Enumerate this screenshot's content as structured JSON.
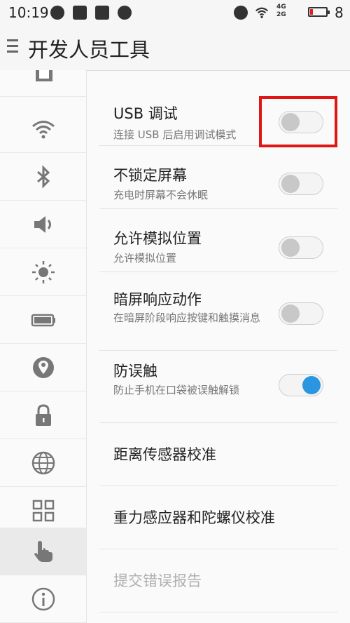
{
  "status": {
    "time": "10:19",
    "network_top": "4G",
    "network_bottom": "2G",
    "battery_level": "8"
  },
  "header": {
    "title": "开发人员工具"
  },
  "sidebar": {
    "items": [
      {
        "icon": "sim-card-icon"
      },
      {
        "icon": "wifi-icon"
      },
      {
        "icon": "bluetooth-icon"
      },
      {
        "icon": "speaker-icon"
      },
      {
        "icon": "brightness-icon"
      },
      {
        "icon": "battery-icon"
      },
      {
        "icon": "location-icon"
      },
      {
        "icon": "lock-icon"
      },
      {
        "icon": "globe-icon"
      },
      {
        "icon": "apps-grid-icon"
      },
      {
        "icon": "hand-pointer-icon",
        "active": true
      },
      {
        "icon": "info-icon"
      }
    ]
  },
  "settings": [
    {
      "title": "USB 调试",
      "subtitle": "连接 USB 后启用调试模式",
      "toggle_on": false
    },
    {
      "title": "不锁定屏幕",
      "subtitle": "充电时屏幕不会休眠",
      "toggle_on": false
    },
    {
      "title": "允许模拟位置",
      "subtitle": "允许模拟位置",
      "toggle_on": false
    },
    {
      "title": "暗屏响应动作",
      "subtitle": "在暗屏阶段响应按键和触摸消息",
      "toggle_on": false
    },
    {
      "title": "防误触",
      "subtitle": "防止手机在口袋被误触解锁",
      "toggle_on": true
    },
    {
      "title": "距离传感器校准"
    },
    {
      "title": "重力感应器和陀螺仪校准"
    },
    {
      "title": "提交错误报告",
      "disabled": true
    }
  ],
  "colors": {
    "accent": "#2a96e0",
    "highlight": "#e01515"
  }
}
